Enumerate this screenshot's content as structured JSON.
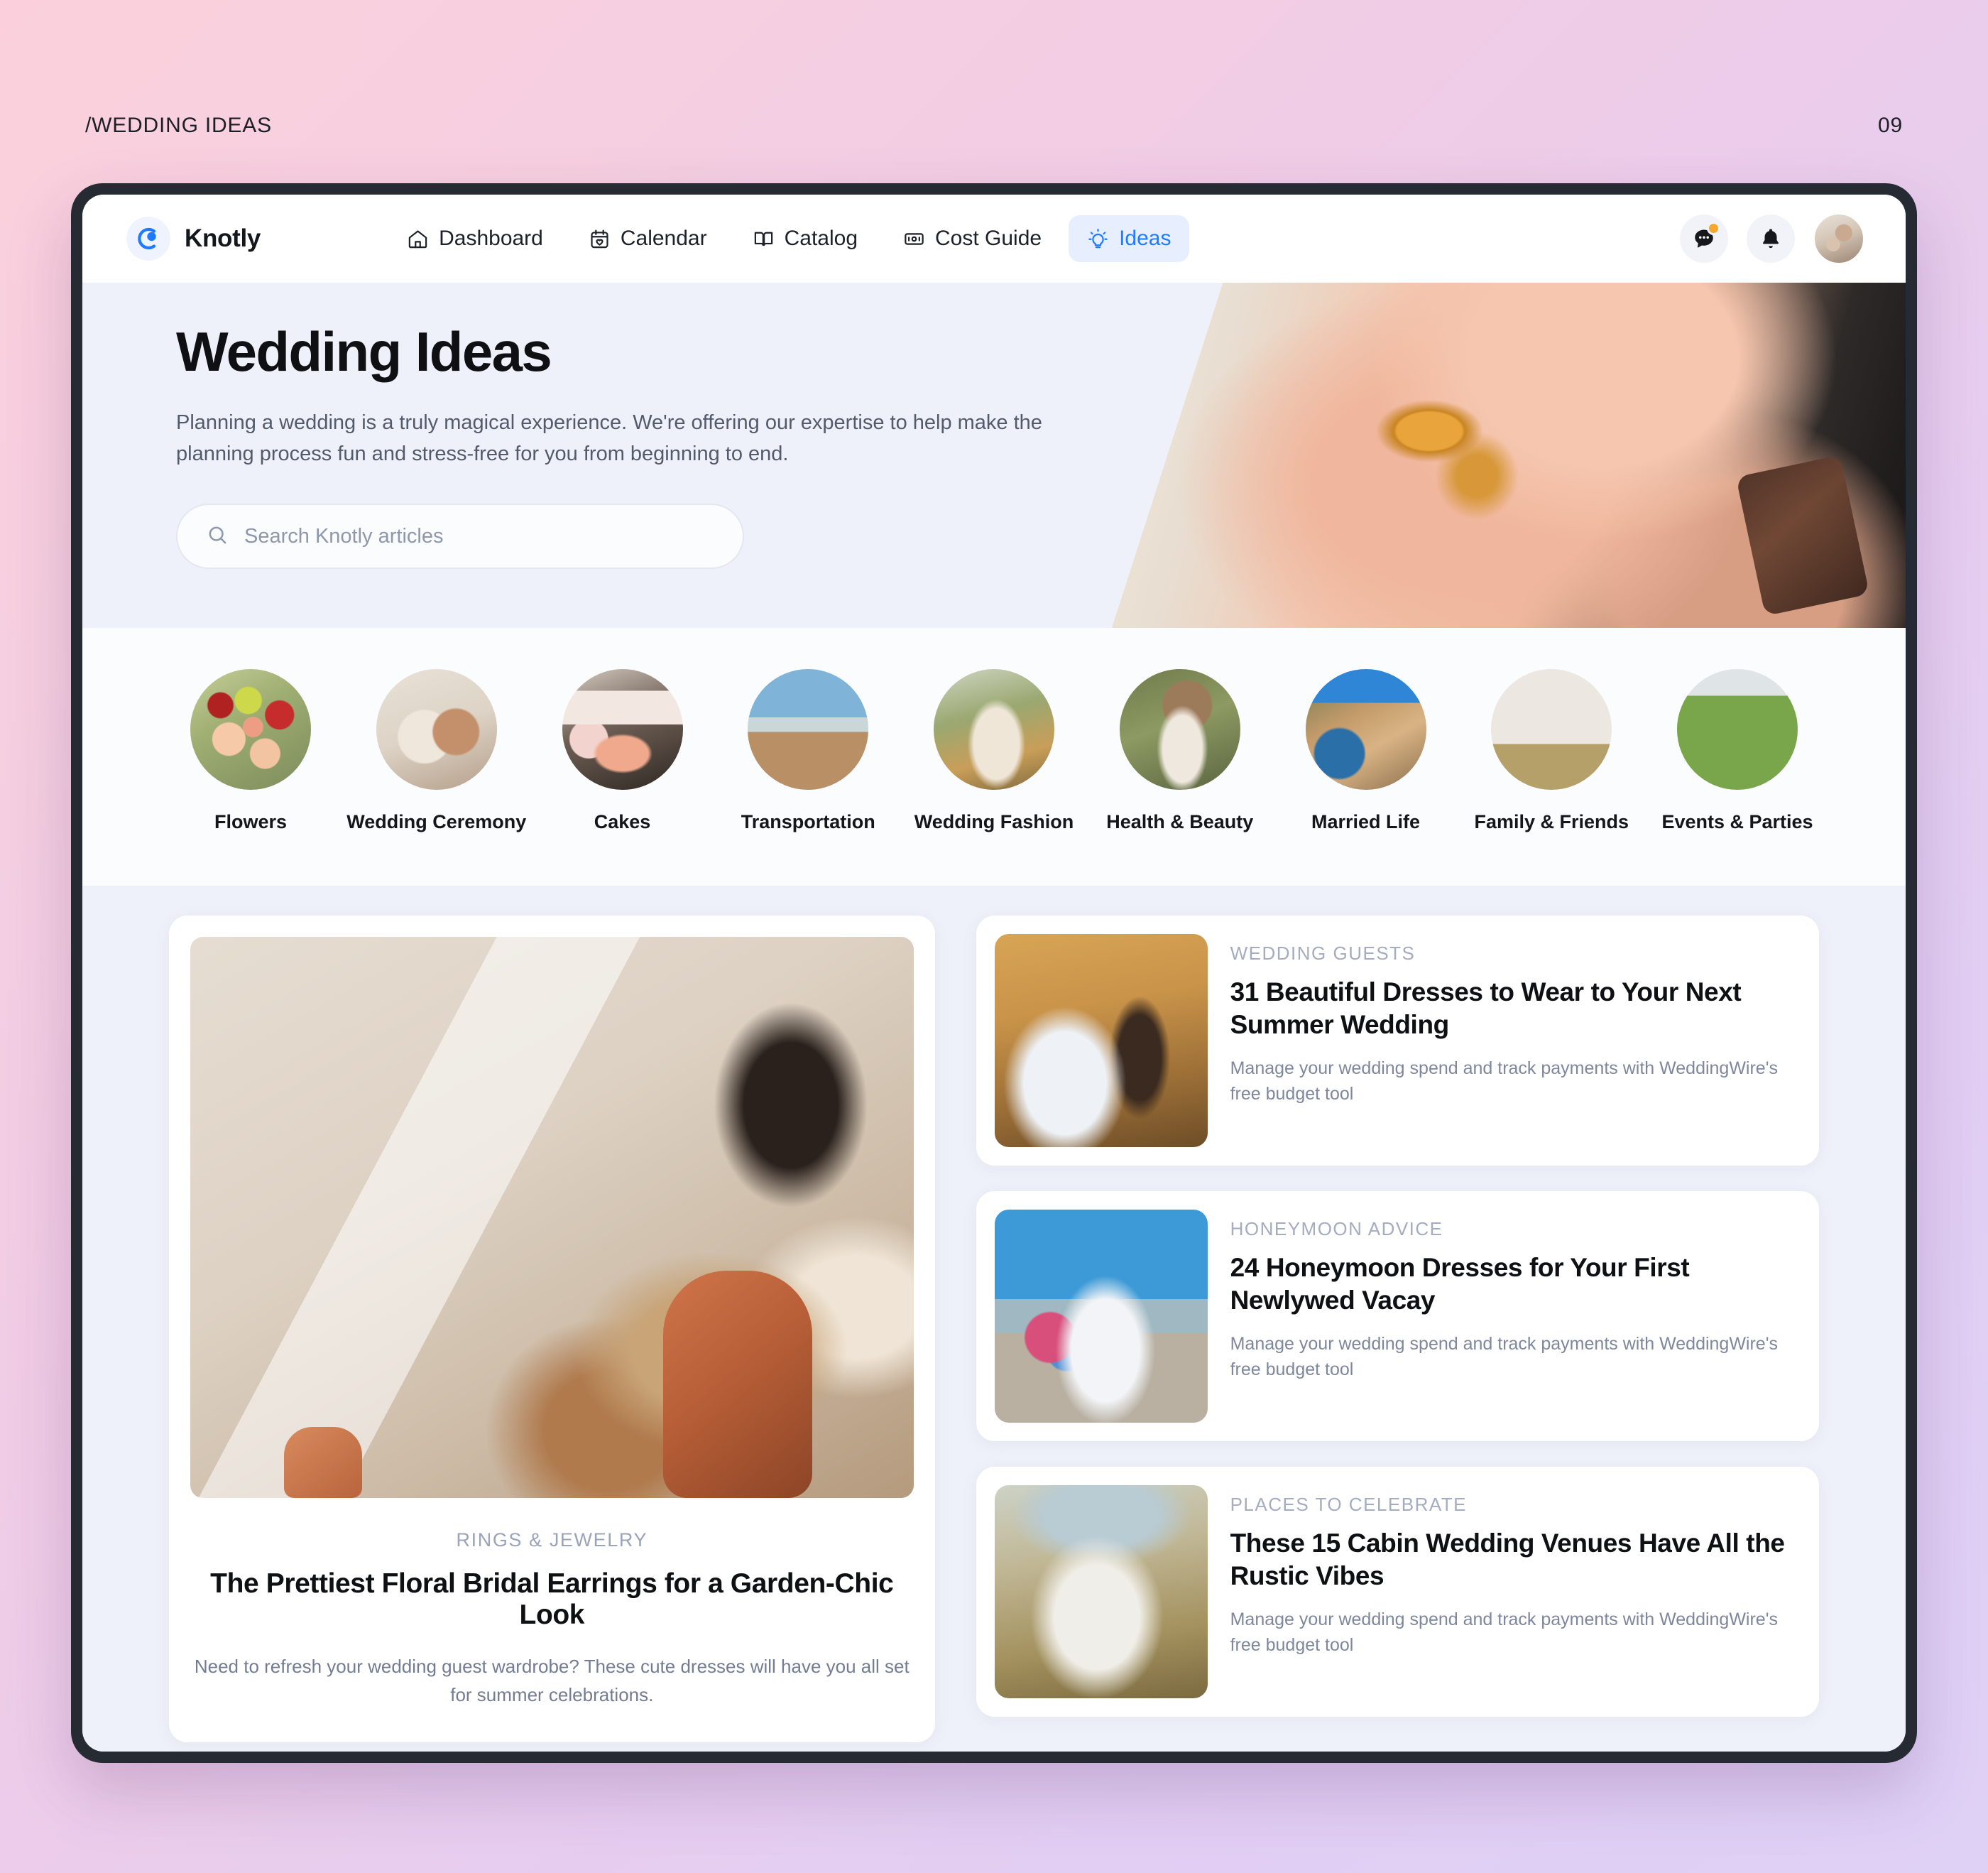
{
  "slide": {
    "label": "/WEDDING IDEAS",
    "page_number": "09",
    "accent_color": "#1f7aff",
    "background_gradient": [
      "#fbd0dc",
      "#dfd0f6"
    ]
  },
  "nav": {
    "brand": "Knotly",
    "brand_icon": "knotly-logo-icon",
    "links": [
      {
        "label": "Dashboard",
        "icon": "home-icon",
        "active": false
      },
      {
        "label": "Calendar",
        "icon": "calendar-heart-icon",
        "active": false
      },
      {
        "label": "Catalog",
        "icon": "open-book-icon",
        "active": false
      },
      {
        "label": "Cost Guide",
        "icon": "banknote-icon",
        "active": false
      },
      {
        "label": "Ideas",
        "icon": "lightbulb-icon",
        "active": true
      }
    ],
    "messages_icon": "chat-bubble-icon",
    "messages_has_unread": true,
    "notifications_icon": "bell-icon",
    "avatar": "user-avatar"
  },
  "hero": {
    "title": "Wedding Ideas",
    "subtitle": "Planning a wedding is a truly magical experience. We're offering our expertise to help make the planning process fun and stress-free for you from beginning to end.",
    "search_placeholder": "Search Knotly articles",
    "search_value": "",
    "search_icon": "search-icon",
    "image": "hands-holding-wedding-rings"
  },
  "categories": [
    {
      "label": "Flowers",
      "thumb_class": "t-flowers",
      "image": "bridal-bouquet"
    },
    {
      "label": "Wedding Ceremony",
      "thumb_class": "t-ceremony",
      "image": "couple-hands-ceremony"
    },
    {
      "label": "Cakes",
      "thumb_class": "t-cakes",
      "image": "tiered-wedding-cake"
    },
    {
      "label": "Transportation",
      "thumb_class": "t-transport",
      "image": "vintage-wedding-car"
    },
    {
      "label": "Wedding Fashion",
      "thumb_class": "t-fashion",
      "image": "bride-in-field"
    },
    {
      "label": "Health & Beauty",
      "thumb_class": "t-beauty",
      "image": "bride-portrait"
    },
    {
      "label": "Married Life",
      "thumb_class": "t-married",
      "image": "coastal-village"
    },
    {
      "label": "Family & Friends",
      "thumb_class": "t-family",
      "image": "wedding-party-cheering"
    },
    {
      "label": "Events & Parties",
      "thumb_class": "t-events",
      "image": "decorated-chairs-lawn"
    }
  ],
  "feature": {
    "kicker": "RINGS & JEWELRY",
    "title": "The Prettiest Floral Bridal Earrings for a Garden-Chic Look",
    "description": "Need to refresh your wedding guest wardrobe? These cute dresses will have you all set for summer celebrations.",
    "image": "bride-with-dried-bouquet"
  },
  "articles": [
    {
      "kicker": "WEDDING GUESTS",
      "title": "31 Beautiful Dresses to Wear to Your Next Summer Wedding",
      "description": "Manage your wedding spend and track payments with WeddingWire's free budget tool",
      "thumb_class": "s-guests",
      "image": "couple-walking-at-sunset"
    },
    {
      "kicker": "HONEYMOON ADVICE",
      "title": "24 Honeymoon Dresses for Your First Newlywed Vacay",
      "description": "Manage your wedding spend and track payments with WeddingWire's free budget tool",
      "thumb_class": "s-honeymoon",
      "image": "bride-with-bouquet-seaside"
    },
    {
      "kicker": "PLACES TO CELEBRATE",
      "title": "These 15 Cabin Wedding Venues Have All the Rustic Vibes",
      "description": "Manage your wedding spend and track payments with WeddingWire's free budget tool",
      "thumb_class": "s-places",
      "image": "bride-in-meadow"
    }
  ]
}
